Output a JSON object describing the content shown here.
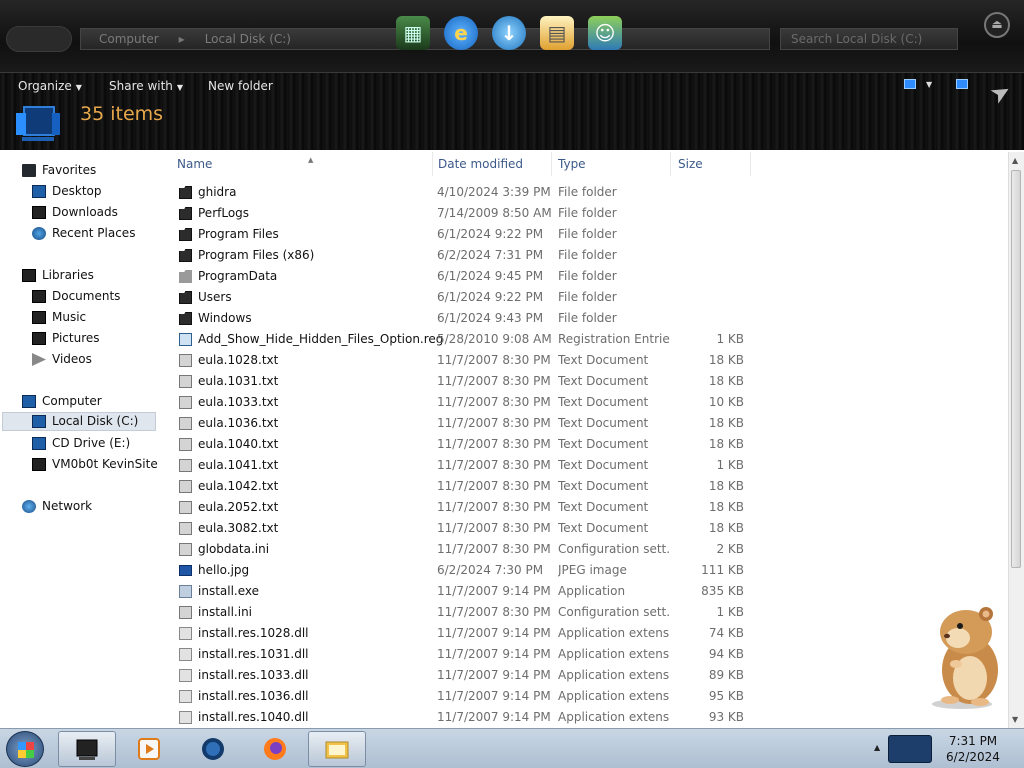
{
  "address": {
    "segments": [
      "Computer",
      "Local Disk (C:)"
    ],
    "search_placeholder": "Search Local Disk (C:)"
  },
  "toolbar": {
    "organize": "Organize",
    "share_with": "Share with",
    "new_folder": "New folder",
    "items_count": "35 items"
  },
  "nav": {
    "favorites": "Favorites",
    "desktop": "Desktop",
    "downloads": "Downloads",
    "recent_places": "Recent Places",
    "libraries": "Libraries",
    "documents": "Documents",
    "music": "Music",
    "pictures": "Pictures",
    "videos": "Videos",
    "computer": "Computer",
    "local_disk": "Local Disk (C:)",
    "cd_drive": "CD Drive (E:)",
    "kevinsite": "VM0b0t KevinSite",
    "network": "Network"
  },
  "columns": {
    "name": "Name",
    "date": "Date modified",
    "type": "Type",
    "size": "Size"
  },
  "files": [
    {
      "name": "ghidra",
      "date": "4/10/2024 3:39 PM",
      "type": "File folder",
      "size": "",
      "icon": "folder"
    },
    {
      "name": "PerfLogs",
      "date": "7/14/2009 8:50 AM",
      "type": "File folder",
      "size": "",
      "icon": "folder"
    },
    {
      "name": "Program Files",
      "date": "6/1/2024 9:22 PM",
      "type": "File folder",
      "size": "",
      "icon": "folder"
    },
    {
      "name": "Program Files (x86)",
      "date": "6/2/2024 7:31 PM",
      "type": "File folder",
      "size": "",
      "icon": "folder"
    },
    {
      "name": "ProgramData",
      "date": "6/1/2024 9:45 PM",
      "type": "File folder",
      "size": "",
      "icon": "folder-light"
    },
    {
      "name": "Users",
      "date": "6/1/2024 9:22 PM",
      "type": "File folder",
      "size": "",
      "icon": "folder"
    },
    {
      "name": "Windows",
      "date": "6/1/2024 9:43 PM",
      "type": "File folder",
      "size": "",
      "icon": "folder"
    },
    {
      "name": "Add_Show_Hide_Hidden_Files_Option.reg",
      "date": "5/28/2010 9:08 AM",
      "type": "Registration Entries",
      "size": "1 KB",
      "icon": "reg"
    },
    {
      "name": "eula.1028.txt",
      "date": "11/7/2007 8:30 PM",
      "type": "Text Document",
      "size": "18 KB",
      "icon": "doc"
    },
    {
      "name": "eula.1031.txt",
      "date": "11/7/2007 8:30 PM",
      "type": "Text Document",
      "size": "18 KB",
      "icon": "doc"
    },
    {
      "name": "eula.1033.txt",
      "date": "11/7/2007 8:30 PM",
      "type": "Text Document",
      "size": "10 KB",
      "icon": "doc"
    },
    {
      "name": "eula.1036.txt",
      "date": "11/7/2007 8:30 PM",
      "type": "Text Document",
      "size": "18 KB",
      "icon": "doc"
    },
    {
      "name": "eula.1040.txt",
      "date": "11/7/2007 8:30 PM",
      "type": "Text Document",
      "size": "18 KB",
      "icon": "doc"
    },
    {
      "name": "eula.1041.txt",
      "date": "11/7/2007 8:30 PM",
      "type": "Text Document",
      "size": "1 KB",
      "icon": "doc"
    },
    {
      "name": "eula.1042.txt",
      "date": "11/7/2007 8:30 PM",
      "type": "Text Document",
      "size": "18 KB",
      "icon": "doc"
    },
    {
      "name": "eula.2052.txt",
      "date": "11/7/2007 8:30 PM",
      "type": "Text Document",
      "size": "18 KB",
      "icon": "doc"
    },
    {
      "name": "eula.3082.txt",
      "date": "11/7/2007 8:30 PM",
      "type": "Text Document",
      "size": "18 KB",
      "icon": "doc"
    },
    {
      "name": "globdata.ini",
      "date": "11/7/2007 8:30 PM",
      "type": "Configuration sett...",
      "size": "2 KB",
      "icon": "doc"
    },
    {
      "name": "hello.jpg",
      "date": "6/2/2024 7:30 PM",
      "type": "JPEG image",
      "size": "111 KB",
      "icon": "img"
    },
    {
      "name": "install.exe",
      "date": "11/7/2007 9:14 PM",
      "type": "Application",
      "size": "835 KB",
      "icon": "exe"
    },
    {
      "name": "install.ini",
      "date": "11/7/2007 8:30 PM",
      "type": "Configuration sett...",
      "size": "1 KB",
      "icon": "doc"
    },
    {
      "name": "install.res.1028.dll",
      "date": "11/7/2007 9:14 PM",
      "type": "Application extens...",
      "size": "74 KB",
      "icon": "dll"
    },
    {
      "name": "install.res.1031.dll",
      "date": "11/7/2007 9:14 PM",
      "type": "Application extens...",
      "size": "94 KB",
      "icon": "dll"
    },
    {
      "name": "install.res.1033.dll",
      "date": "11/7/2007 9:14 PM",
      "type": "Application extens...",
      "size": "89 KB",
      "icon": "dll"
    },
    {
      "name": "install.res.1036.dll",
      "date": "11/7/2007 9:14 PM",
      "type": "Application extens...",
      "size": "95 KB",
      "icon": "dll"
    },
    {
      "name": "install.res.1040.dll",
      "date": "11/7/2007 9:14 PM",
      "type": "Application extens...",
      "size": "93 KB",
      "icon": "dll"
    }
  ],
  "clock": {
    "time": "7:31 PM",
    "date": "6/2/2024"
  },
  "colors": {
    "items_count": "#e8a84c",
    "column_header": "#3c5a8a"
  }
}
